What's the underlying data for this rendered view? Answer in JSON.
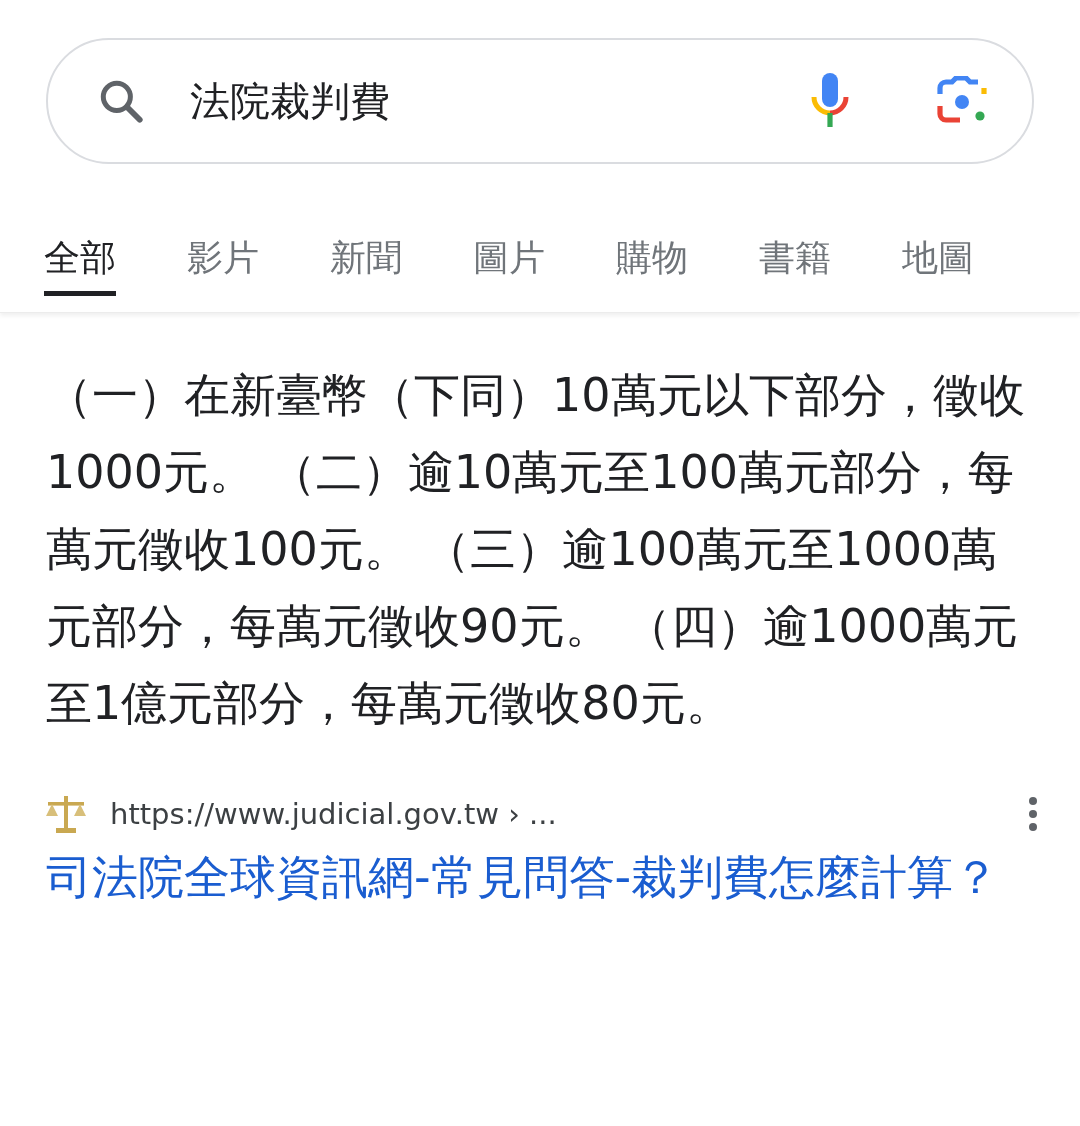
{
  "search": {
    "query": "法院裁判費"
  },
  "tabs": [
    {
      "label": "全部",
      "selected": true
    },
    {
      "label": "影片",
      "selected": false
    },
    {
      "label": "新聞",
      "selected": false
    },
    {
      "label": "圖片",
      "selected": false
    },
    {
      "label": "購物",
      "selected": false
    },
    {
      "label": "書籍",
      "selected": false
    },
    {
      "label": "地圖",
      "selected": false
    }
  ],
  "snippet": {
    "text": "（一）在新臺幣（下同）10萬元以下部分，徵收1000元。 （二）逾10萬元至100萬元部分，每萬元徵收100元。 （三）逾100萬元至1000萬元部分，每萬元徵收90元。 （四）逾1000萬元至1億元部分，每萬元徵收80元。"
  },
  "result": {
    "url": "https://www.judicial.gov.tw › ...",
    "title": "司法院全球資訊網-常見問答-裁判費怎麼計算？"
  }
}
